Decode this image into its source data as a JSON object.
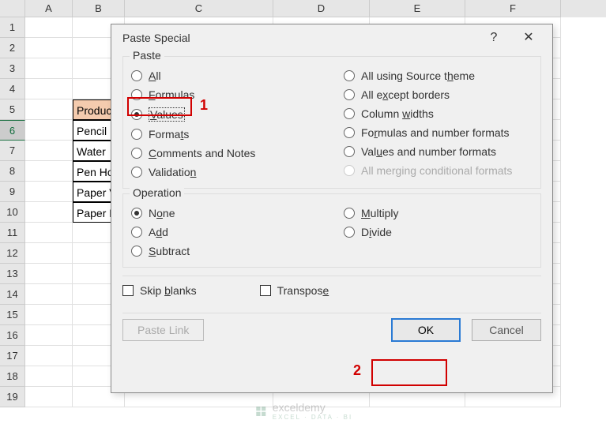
{
  "columns": {
    "A": 60,
    "B": 66,
    "C": 188,
    "D": 122,
    "E": 121,
    "F": 121
  },
  "rows": [
    "1",
    "2",
    "3",
    "4",
    "5",
    "6",
    "7",
    "8",
    "9",
    "10",
    "11",
    "12",
    "13",
    "14",
    "15",
    "16",
    "17",
    "18",
    "19"
  ],
  "sheet": {
    "b5": "Produc",
    "b6": "Pencil",
    "b7": "Water",
    "b8": "Pen Ho",
    "b9": "Paper V",
    "b10": "Paper E"
  },
  "dialog": {
    "title": "Paste Special",
    "help": "?",
    "close": "✕",
    "paste_legend": "Paste",
    "paste_left": {
      "all": "All",
      "formulas": "Formulas",
      "values": "Values",
      "formats": "Formats",
      "comments": "Comments and Notes",
      "validation": "Validation"
    },
    "paste_right": {
      "theme": "All using Source theme",
      "except_borders": "All except borders",
      "widths": "Column widths",
      "fnum": "Formulas and number formats",
      "vnum": "Values and number formats",
      "cond": "All merging conditional formats"
    },
    "op_legend": "Operation",
    "op_left": {
      "none": "None",
      "add": "Add",
      "subtract": "Subtract"
    },
    "op_right": {
      "multiply": "Multiply",
      "divide": "Divide"
    },
    "skip": "Skip blanks",
    "transpose": "Transpose",
    "paste_link": "Paste Link",
    "ok": "OK",
    "cancel": "Cancel"
  },
  "anno": {
    "a1": "1",
    "a2": "2"
  },
  "watermark": {
    "brand": "exceldemy",
    "tag": "EXCEL · DATA · BI"
  }
}
